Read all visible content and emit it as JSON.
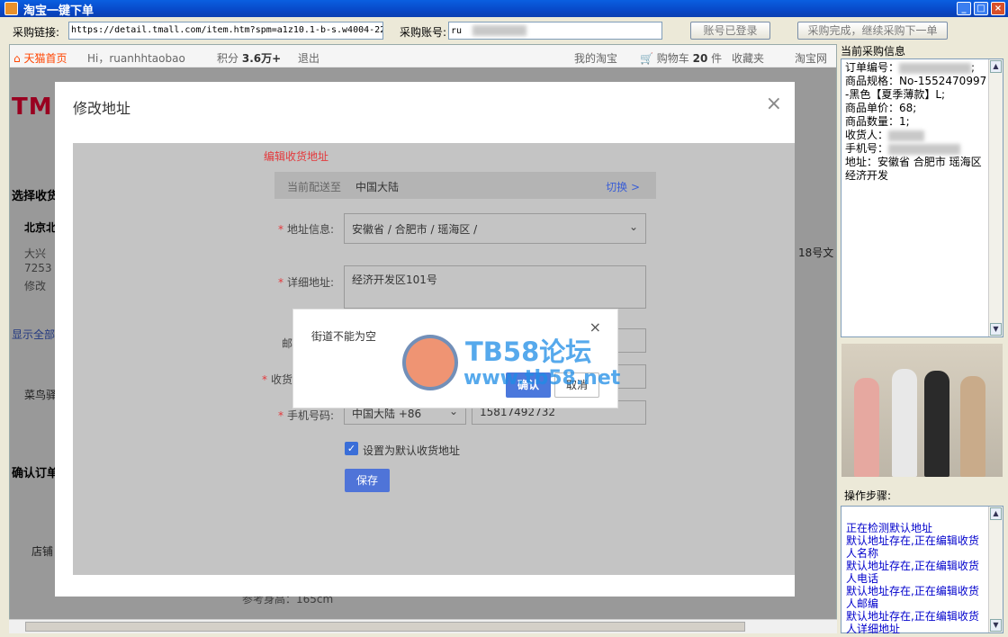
{
  "window": {
    "title": "淘宝一键下单",
    "buttons": {
      "min": "_",
      "max": "□",
      "close": "×"
    }
  },
  "toolbar": {
    "link_label": "采购链接:",
    "link_value": "https://detail.tmall.com/item.htm?spm=a1z10.1-b-s.w4004-22",
    "account_label": "采购账号:",
    "account_value": "ru",
    "logged_in_button": "账号已登录",
    "next_button": "采购完成，继续采购下一单"
  },
  "tmall_nav": {
    "home": "天猫首页",
    "greeting": "Hi，ruanhhtaobao",
    "points_label": "积分",
    "points_value": "3.6万+",
    "logout": "退出",
    "my_taobao": "我的淘宝",
    "cart_label": "购物车",
    "cart_count": "20",
    "cart_unit": "件",
    "favorites": "收藏夹",
    "taobao_site": "淘宝网"
  },
  "page_bg": {
    "logo": "TM",
    "select_addr": "选择收货",
    "beijing": "北京北",
    "daxing": "大兴",
    "code": "7253",
    "modify": "修改",
    "show_all": "显示全部",
    "cainiao": "菜鸟驿",
    "confirm_order": "确认订单",
    "shop": "店铺",
    "right_text": "18号文",
    "height_ref": "参考身高：165cm"
  },
  "dialog": {
    "title": "修改地址",
    "close": "×",
    "section_title": "编辑收货地址",
    "ship_to_label": "当前配送至",
    "ship_to_value": "中国大陆",
    "switch": "切换 >",
    "region_label": "地址信息:",
    "region_value": "安徽省 / 合肥市 / 瑶海区 /",
    "detail_label": "详细地址:",
    "detail_value": "经济开发区101号",
    "zip_label": "邮",
    "receiver_label": "收货",
    "phone_label": "手机号码:",
    "phone_country": "中国大陆 +86",
    "phone_value": "15817492732",
    "default_label": "设置为默认收货地址",
    "save": "保存"
  },
  "alert": {
    "message": "街道不能为空",
    "close": "×",
    "ok": "确认",
    "cancel": "取消"
  },
  "watermark": {
    "line1": "TB58论坛",
    "line2": "www.tb58.net"
  },
  "right_panel": {
    "info_title": "当前采购信息",
    "order_no": "订单编号：",
    "spec": "商品规格：No-1552470997-黑色【夏季薄款】L;",
    "price": "商品单价：68;",
    "qty": "商品数量：1;",
    "receiver": "收货人：",
    "phone": "手机号：",
    "address": "地址：安徽省 合肥市 瑶海区 经济开发",
    "steps_title": "操作步骤:",
    "steps": [
      "正在检测默认地址",
      "默认地址存在,正在编辑收货人名称",
      "默认地址存在,正在编辑收货人电话",
      "默认地址存在,正在编辑收货人邮编",
      "默认地址存在,正在编辑收货人详细地址"
    ]
  }
}
